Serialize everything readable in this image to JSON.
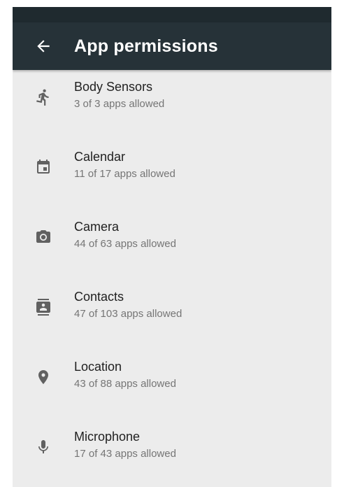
{
  "theme": {
    "toolbar_color": "#263238",
    "status_bar_color": "#1f2a2f",
    "background_color": "#ececec",
    "icon_color": "#616161"
  },
  "header": {
    "back_icon": "arrow-back-icon",
    "title": "App permissions"
  },
  "permissions": [
    {
      "icon": "running-person-icon",
      "title": "Body Sensors",
      "summary": "3 of 3 apps allowed"
    },
    {
      "icon": "calendar-icon",
      "title": "Calendar",
      "summary": "11 of 17 apps allowed"
    },
    {
      "icon": "camera-icon",
      "title": "Camera",
      "summary": "44 of 63 apps allowed"
    },
    {
      "icon": "contacts-icon",
      "title": "Contacts",
      "summary": "47 of 103 apps allowed"
    },
    {
      "icon": "location-pin-icon",
      "title": "Location",
      "summary": "43 of 88 apps allowed"
    },
    {
      "icon": "microphone-icon",
      "title": "Microphone",
      "summary": "17 of 43 apps allowed"
    }
  ]
}
